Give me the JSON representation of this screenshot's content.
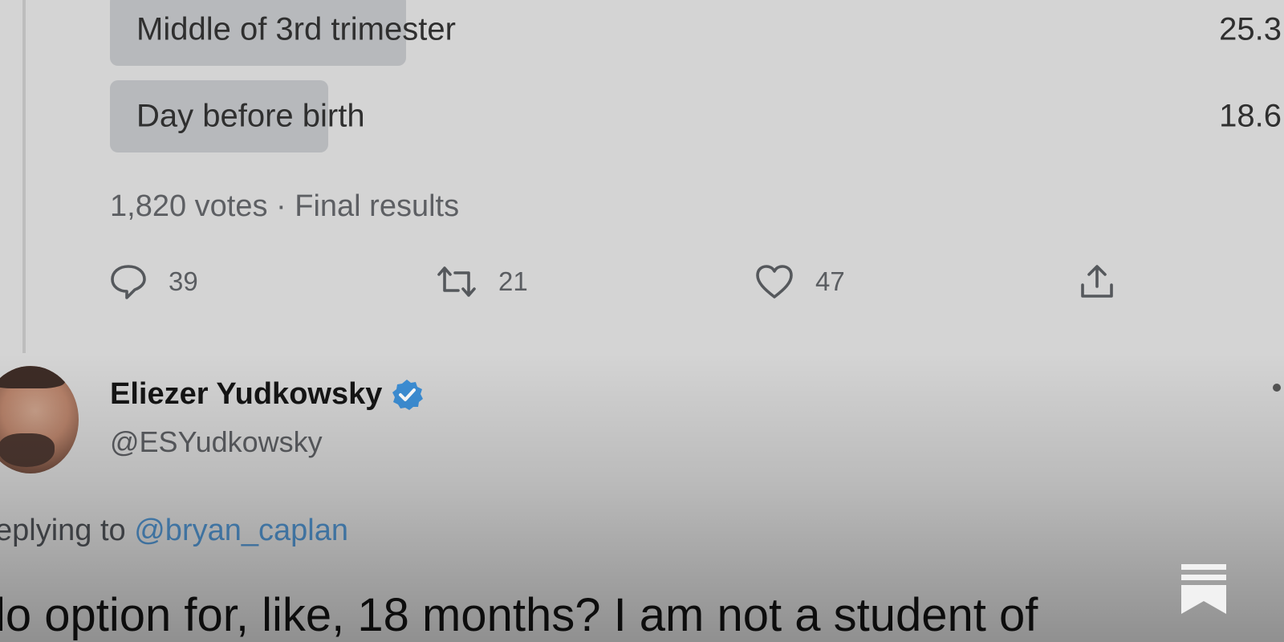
{
  "poll": {
    "options": [
      {
        "label": "Middle of 3rd trimester",
        "percent": "25.3",
        "fill_fraction": 0.253
      },
      {
        "label": "Day before birth",
        "percent": "18.6",
        "fill_fraction": 0.186
      }
    ],
    "summary": "1,820 votes · Final results"
  },
  "actions": {
    "replies": "39",
    "retweets": "21",
    "likes": "47"
  },
  "reply_tweet": {
    "author_name": "Eliezer Yudkowsky",
    "handle": "@ESYudkowsky",
    "replying_prefix": "eplying to ",
    "replying_to": "@bryan_caplan",
    "text": "lo option for, like, 18 months?  I am not a student of"
  },
  "icons": {
    "reply": "reply-icon",
    "retweet": "retweet-icon",
    "like": "heart-icon",
    "share": "share-icon",
    "verified": "verified-badge-icon",
    "logo": "substack-logo-icon"
  },
  "colors": {
    "background": "#d4d4d4",
    "poll_fill": "#b7b9bc",
    "verified_blue": "#3d8fd6",
    "mention_blue": "#4d8cc4",
    "muted_text": "#5d5f63"
  }
}
